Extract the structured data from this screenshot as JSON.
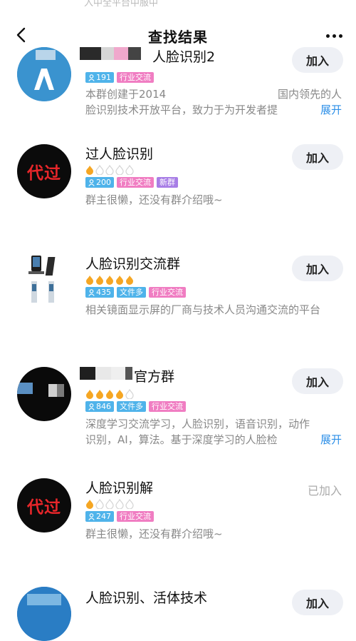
{
  "top_fade_text": "入中全平台中服中",
  "header": {
    "title": "查找结果"
  },
  "groups": [
    {
      "name": "人脸识别2",
      "members": "191",
      "tags": [
        "行业交流"
      ],
      "desc_line1": "本群创建于2014",
      "desc_line1_right": "国内领先的人",
      "desc_line2": "脸识别技术开放平台，致力于为开发者提",
      "expand": "展开",
      "action": "加入"
    },
    {
      "avatar_text": "代过",
      "name": "过人脸识别",
      "members": "200",
      "tags": [
        "行业交流",
        "新群"
      ],
      "desc": "群主很懒，还没有群介绍哦~",
      "action": "加入"
    },
    {
      "name": "人脸识别交流群",
      "members": "435",
      "tags": [
        "文件多",
        "行业交流"
      ],
      "desc": "相关镜面显示屏的厂商与技术人员沟通交流的平台",
      "action": "加入"
    },
    {
      "name": "官方群",
      "members": "846",
      "tags": [
        "文件多",
        "行业交流"
      ],
      "desc_line1": "深度学习交流学习，人脸识别，语音识别，动作",
      "desc_line2": "识别，AI，算法。基于深度学习的人脸检",
      "expand": "展开",
      "action": "加入"
    },
    {
      "avatar_text": "代过",
      "name": "人脸识别解",
      "members": "247",
      "tags": [
        "行业交流"
      ],
      "desc": "群主很懒，还没有群介绍哦~",
      "action": "已加入"
    },
    {
      "name": "人脸识别、活体技术",
      "action": "加入"
    }
  ],
  "colors": {
    "accent": "#2c8fe8",
    "flame": "#f5a623",
    "industry_tag": "#f07dc2",
    "members_tag": "#4fb3ea"
  }
}
